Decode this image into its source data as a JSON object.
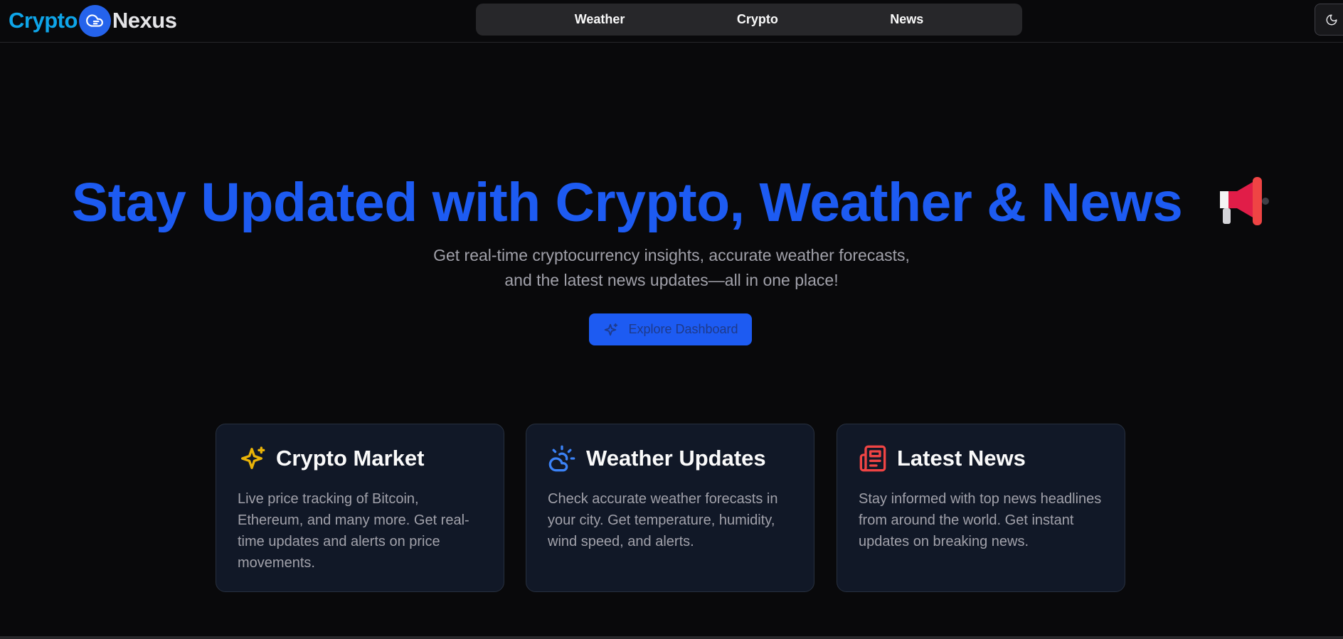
{
  "header": {
    "brand_part1": "Crypto",
    "brand_part2": "Nexus",
    "nav": [
      "Weather",
      "Crypto",
      "News"
    ],
    "theme_icon": "moon-icon"
  },
  "hero": {
    "title": "Stay Updated with Crypto, Weather & News",
    "title_icon": "megaphone-icon",
    "subtitle_line1": "Get real-time cryptocurrency insights, accurate weather forecasts,",
    "subtitle_line2": "and the latest news updates—all in one place!",
    "cta_label": "Explore Dashboard",
    "cta_icon": "sparkles-icon"
  },
  "cards": [
    {
      "title": "Crypto Market",
      "icon": "sparkles-icon",
      "text": "Live price tracking of Bitcoin, Ethereum, and many more. Get real-time updates and alerts on price movements."
    },
    {
      "title": "Weather Updates",
      "icon": "cloud-sun-icon",
      "text": "Check accurate weather forecasts in your city. Get temperature, humidity, wind speed, and alerts."
    },
    {
      "title": "Latest News",
      "icon": "newspaper-icon",
      "text": "Stay informed with top news headlines from around the world. Get instant updates on breaking news."
    }
  ],
  "colors": {
    "background": "#09090b",
    "accent": "#1d5bf2",
    "brand_cyan": "#0ea5e9",
    "card_bg": "#111827",
    "muted_text": "#a1a1aa"
  }
}
